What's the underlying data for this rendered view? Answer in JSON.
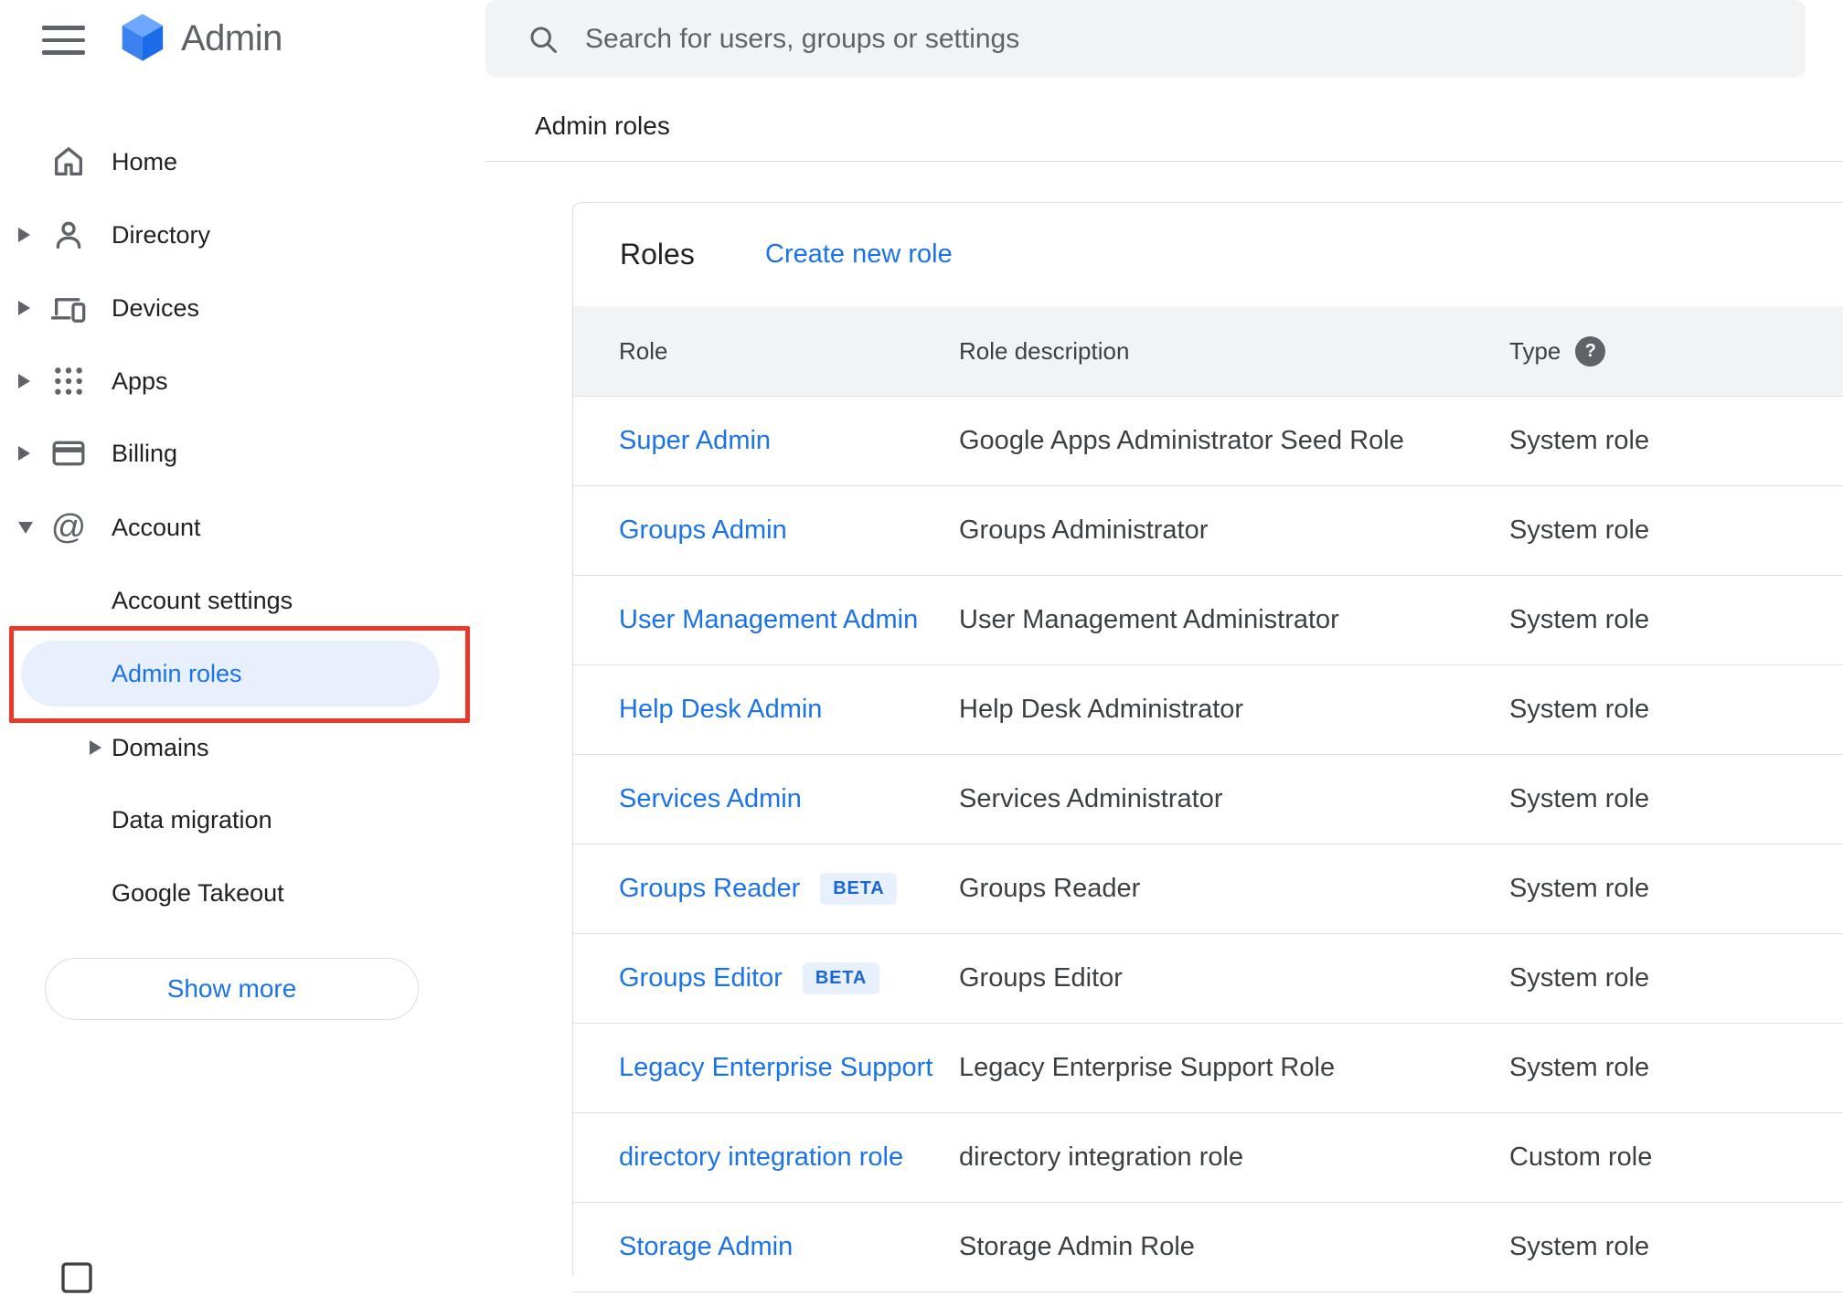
{
  "topbar": {
    "logo_text": "Admin",
    "search_placeholder": "Search for users, groups or settings"
  },
  "breadcrumb": "Admin roles",
  "sidebar": {
    "items": [
      {
        "label": "Home"
      },
      {
        "label": "Directory"
      },
      {
        "label": "Devices"
      },
      {
        "label": "Apps"
      },
      {
        "label": "Billing"
      },
      {
        "label": "Account"
      }
    ],
    "sub_items": [
      {
        "label": "Account settings"
      },
      {
        "label": "Admin roles"
      },
      {
        "label": "Domains"
      },
      {
        "label": "Data migration"
      },
      {
        "label": "Google Takeout"
      }
    ],
    "at_glyph": "@",
    "show_more_label": "Show more"
  },
  "main": {
    "title": "Roles",
    "create_link": "Create new role",
    "table": {
      "columns": [
        "Role",
        "Role description",
        "Type"
      ],
      "help_glyph": "?",
      "beta_label": "BETA",
      "rows": [
        {
          "role": "Super Admin",
          "description": "Google Apps Administrator Seed Role",
          "type": "System role"
        },
        {
          "role": "Groups Admin",
          "description": "Groups Administrator",
          "type": "System role"
        },
        {
          "role": "User Management Admin",
          "description": "User Management Administrator",
          "type": "System role"
        },
        {
          "role": "Help Desk Admin",
          "description": "Help Desk Administrator",
          "type": "System role"
        },
        {
          "role": "Services Admin",
          "description": "Services Administrator",
          "type": "System role"
        },
        {
          "role": "Groups Reader",
          "description": "Groups Reader",
          "type": "System role"
        },
        {
          "role": "Groups Editor",
          "description": "Groups Editor",
          "type": "System role"
        },
        {
          "role": "Legacy Enterprise Support",
          "description": "Legacy Enterprise Support Role",
          "type": "System role"
        },
        {
          "role": "directory integration role",
          "description": "directory integration role",
          "type": "Custom role"
        },
        {
          "role": "Storage Admin",
          "description": "Storage Admin Role",
          "type": "System role"
        }
      ]
    }
  },
  "colors": {
    "accent": "#1a73e8",
    "accent-dark": "#1967d2",
    "red": "#ea3829",
    "grey-bg": "#f1f3f4",
    "pill": "#e8f0fe"
  }
}
